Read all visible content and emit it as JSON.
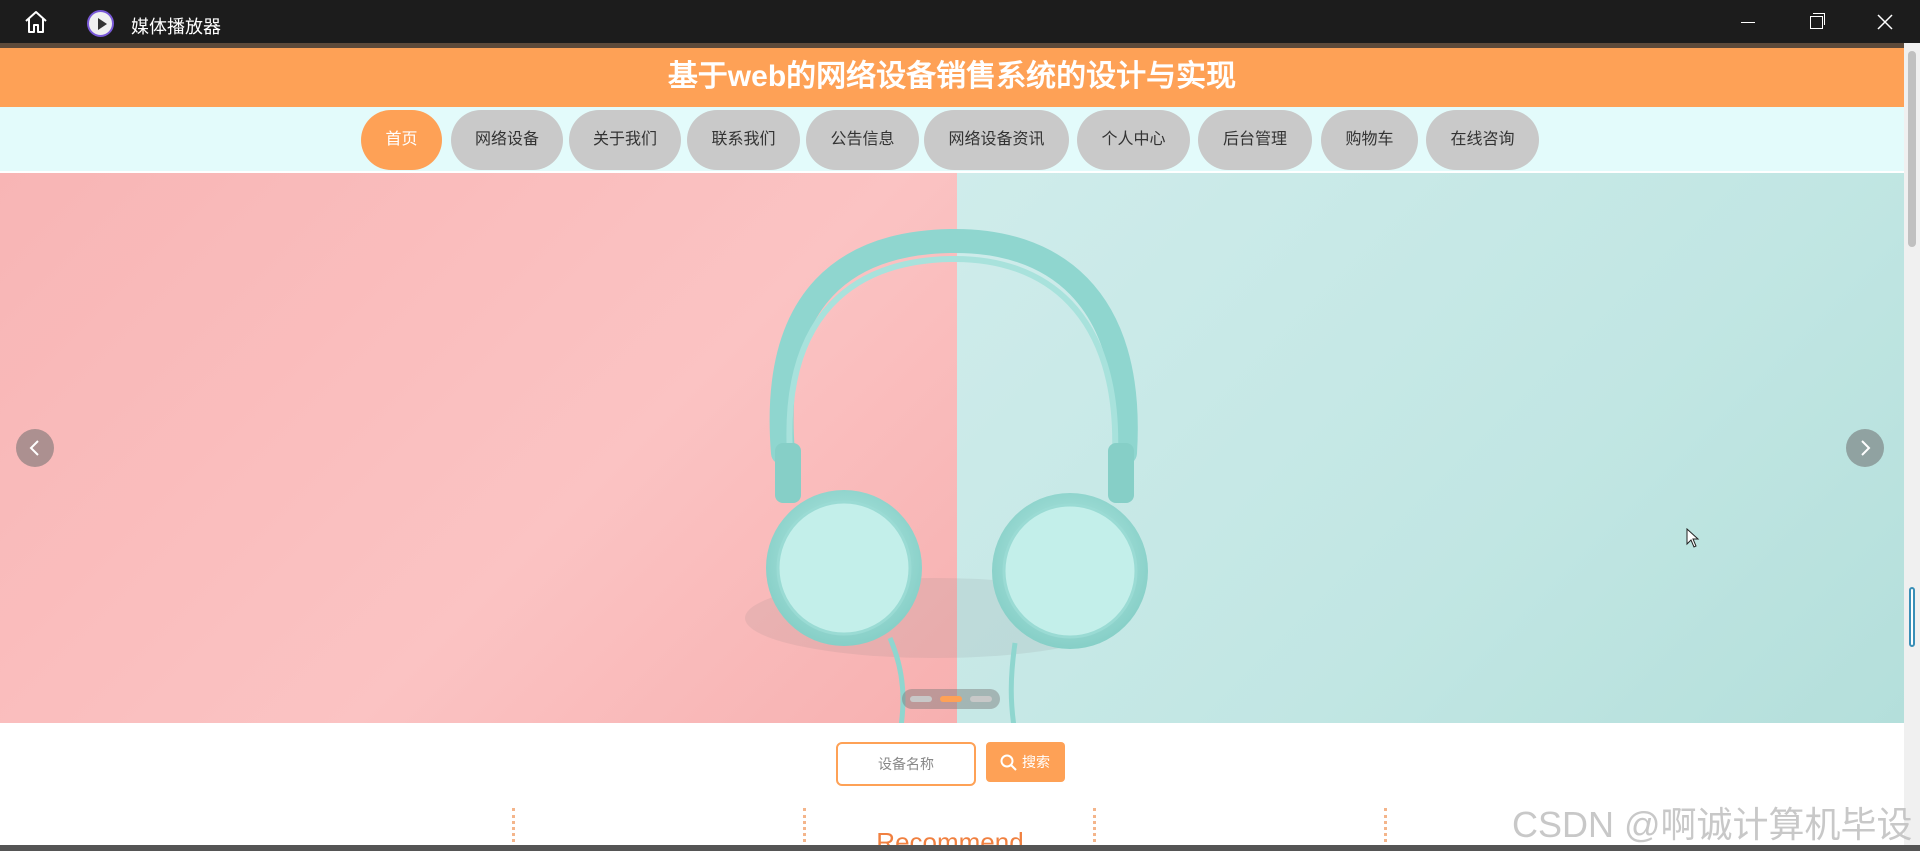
{
  "window": {
    "title": "媒体播放器",
    "icons": [
      "home-icon",
      "media-player-icon",
      "minimize-icon",
      "maximize-icon",
      "close-icon"
    ]
  },
  "header": {
    "title": "基于web的网络设备销售系统的设计与实现"
  },
  "nav": {
    "items": [
      {
        "label": "首页",
        "active": true
      },
      {
        "label": "网络设备",
        "active": false
      },
      {
        "label": "关于我们",
        "active": false
      },
      {
        "label": "联系我们",
        "active": false
      },
      {
        "label": "公告信息",
        "active": false
      },
      {
        "label": "网络设备资讯",
        "active": false
      },
      {
        "label": "个人中心",
        "active": false
      },
      {
        "label": "后台管理",
        "active": false
      },
      {
        "label": "购物车",
        "active": false
      },
      {
        "label": "在线咨询",
        "active": false
      }
    ]
  },
  "banner": {
    "slide_count": 3,
    "active_slide": 2,
    "colors": {
      "left": "#f8b5b5",
      "right": "#c1e6e3",
      "headphones": "#8fd6cf"
    }
  },
  "search": {
    "placeholder": "设备名称",
    "button_label": "搜索"
  },
  "section": {
    "title": "Recommend"
  },
  "watermark": "CSDN @啊诚计算机毕设",
  "theme": {
    "accent": "#fea156",
    "nav_bg": "#e3fbfb",
    "nav_item_bg": "#c9c9c9"
  }
}
